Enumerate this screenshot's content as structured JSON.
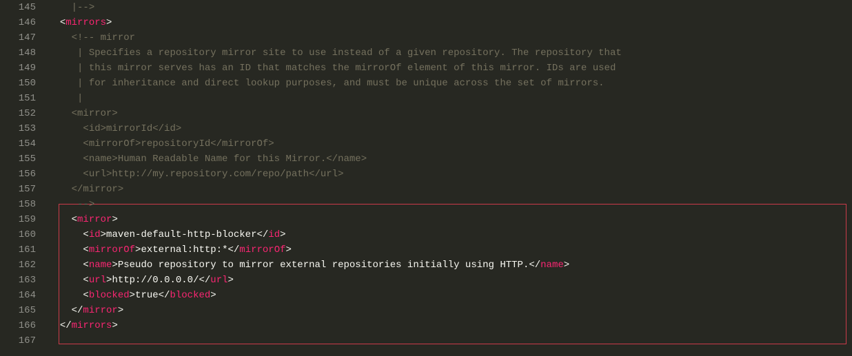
{
  "highlight": {
    "startLine": 159,
    "endLine": 167
  },
  "lines": [
    {
      "n": 145,
      "indent": "    ",
      "tokens": [
        {
          "t": "|-->",
          "cls": "c-comment"
        }
      ]
    },
    {
      "n": 146,
      "indent": "  ",
      "tokens": [
        {
          "t": "<",
          "cls": "c-punct"
        },
        {
          "t": "mirrors",
          "cls": "c-tag"
        },
        {
          "t": ">",
          "cls": "c-punct"
        }
      ]
    },
    {
      "n": 147,
      "indent": "    ",
      "tokens": [
        {
          "t": "<!-- mirror",
          "cls": "c-comment"
        }
      ]
    },
    {
      "n": 148,
      "indent": "     ",
      "tokens": [
        {
          "t": "| Specifies a repository mirror site to use instead of a given repository. The repository that",
          "cls": "c-comment"
        }
      ]
    },
    {
      "n": 149,
      "indent": "     ",
      "tokens": [
        {
          "t": "| this mirror serves has an ID that matches the mirrorOf element of this mirror. IDs are used",
          "cls": "c-comment"
        }
      ]
    },
    {
      "n": 150,
      "indent": "     ",
      "tokens": [
        {
          "t": "| for inheritance and direct lookup purposes, and must be unique across the set of mirrors.",
          "cls": "c-comment"
        }
      ]
    },
    {
      "n": 151,
      "indent": "     ",
      "tokens": [
        {
          "t": "|",
          "cls": "c-comment"
        }
      ]
    },
    {
      "n": 152,
      "indent": "    ",
      "tokens": [
        {
          "t": "<mirror>",
          "cls": "c-comment"
        }
      ]
    },
    {
      "n": 153,
      "indent": "      ",
      "tokens": [
        {
          "t": "<id>mirrorId</id>",
          "cls": "c-comment"
        }
      ]
    },
    {
      "n": 154,
      "indent": "      ",
      "tokens": [
        {
          "t": "<mirrorOf>repositoryId</mirrorOf>",
          "cls": "c-comment"
        }
      ]
    },
    {
      "n": 155,
      "indent": "      ",
      "tokens": [
        {
          "t": "<name>Human Readable Name for this Mirror.</name>",
          "cls": "c-comment"
        }
      ]
    },
    {
      "n": 156,
      "indent": "      ",
      "tokens": [
        {
          "t": "<url>http://my.repository.com/repo/path</url>",
          "cls": "c-comment"
        }
      ]
    },
    {
      "n": 157,
      "indent": "    ",
      "tokens": [
        {
          "t": "</mirror>",
          "cls": "c-comment"
        }
      ]
    },
    {
      "n": 158,
      "indent": "     ",
      "tokens": [
        {
          "t": "-->",
          "cls": "c-comment"
        }
      ]
    },
    {
      "n": 159,
      "indent": "    ",
      "tokens": [
        {
          "t": "<",
          "cls": "c-punct"
        },
        {
          "t": "mirror",
          "cls": "c-tag"
        },
        {
          "t": ">",
          "cls": "c-punct"
        }
      ]
    },
    {
      "n": 160,
      "indent": "      ",
      "tokens": [
        {
          "t": "<",
          "cls": "c-punct"
        },
        {
          "t": "id",
          "cls": "c-tag"
        },
        {
          "t": ">",
          "cls": "c-punct"
        },
        {
          "t": "maven-default-http-blocker",
          "cls": "c-text"
        },
        {
          "t": "</",
          "cls": "c-punct"
        },
        {
          "t": "id",
          "cls": "c-tag"
        },
        {
          "t": ">",
          "cls": "c-punct"
        }
      ]
    },
    {
      "n": 161,
      "indent": "      ",
      "tokens": [
        {
          "t": "<",
          "cls": "c-punct"
        },
        {
          "t": "mirrorOf",
          "cls": "c-tag"
        },
        {
          "t": ">",
          "cls": "c-punct"
        },
        {
          "t": "external:http:*",
          "cls": "c-text"
        },
        {
          "t": "</",
          "cls": "c-punct"
        },
        {
          "t": "mirrorOf",
          "cls": "c-tag"
        },
        {
          "t": ">",
          "cls": "c-punct"
        }
      ]
    },
    {
      "n": 162,
      "indent": "      ",
      "tokens": [
        {
          "t": "<",
          "cls": "c-punct"
        },
        {
          "t": "name",
          "cls": "c-tag"
        },
        {
          "t": ">",
          "cls": "c-punct"
        },
        {
          "t": "Pseudo repository to mirror external repositories initially using HTTP.",
          "cls": "c-text"
        },
        {
          "t": "</",
          "cls": "c-punct"
        },
        {
          "t": "name",
          "cls": "c-tag"
        },
        {
          "t": ">",
          "cls": "c-punct"
        }
      ]
    },
    {
      "n": 163,
      "indent": "      ",
      "tokens": [
        {
          "t": "<",
          "cls": "c-punct"
        },
        {
          "t": "url",
          "cls": "c-tag"
        },
        {
          "t": ">",
          "cls": "c-punct"
        },
        {
          "t": "http://0.0.0.0/",
          "cls": "c-text"
        },
        {
          "t": "</",
          "cls": "c-punct"
        },
        {
          "t": "url",
          "cls": "c-tag"
        },
        {
          "t": ">",
          "cls": "c-punct"
        }
      ]
    },
    {
      "n": 164,
      "indent": "      ",
      "tokens": [
        {
          "t": "<",
          "cls": "c-punct"
        },
        {
          "t": "blocked",
          "cls": "c-tag"
        },
        {
          "t": ">",
          "cls": "c-punct"
        },
        {
          "t": "true",
          "cls": "c-text"
        },
        {
          "t": "</",
          "cls": "c-punct"
        },
        {
          "t": "blocked",
          "cls": "c-tag"
        },
        {
          "t": ">",
          "cls": "c-punct"
        }
      ]
    },
    {
      "n": 165,
      "indent": "    ",
      "tokens": [
        {
          "t": "</",
          "cls": "c-punct"
        },
        {
          "t": "mirror",
          "cls": "c-tag"
        },
        {
          "t": ">",
          "cls": "c-punct"
        }
      ]
    },
    {
      "n": 166,
      "indent": "  ",
      "tokens": [
        {
          "t": "</",
          "cls": "c-punct"
        },
        {
          "t": "mirrors",
          "cls": "c-tag"
        },
        {
          "t": ">",
          "cls": "c-punct"
        }
      ]
    },
    {
      "n": 167,
      "indent": "",
      "tokens": []
    }
  ]
}
